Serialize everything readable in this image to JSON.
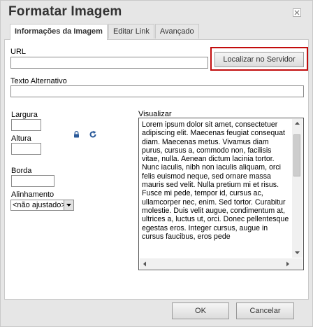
{
  "dialog": {
    "title": "Formatar Imagem"
  },
  "tabs": [
    {
      "label": "Informações da Imagem",
      "active": true
    },
    {
      "label": "Editar Link",
      "active": false
    },
    {
      "label": "Avançado",
      "active": false
    }
  ],
  "fields": {
    "url_label": "URL",
    "url_value": "",
    "browse_label": "Localizar no Servidor",
    "alt_label": "Texto Alternativo",
    "alt_value": "",
    "width_label": "Largura",
    "width_value": "",
    "height_label": "Altura",
    "height_value": "",
    "border_label": "Borda",
    "border_value": "",
    "align_label": "Alinhamento",
    "align_value": "<não ajustado>"
  },
  "preview": {
    "label": "Visualizar",
    "text": "Lorem ipsum dolor sit amet, consectetuer adipiscing elit. Maecenas feugiat consequat diam. Maecenas metus. Vivamus diam purus, cursus a, commodo non, facilisis vitae, nulla. Aenean dictum lacinia tortor. Nunc iaculis, nibh non iaculis aliquam, orci felis euismod neque, sed ornare massa mauris sed velit. Nulla pretium mi et risus. Fusce mi pede, tempor id, cursus ac, ullamcorper nec, enim. Sed tortor. Curabitur molestie. Duis velit augue, condimentum at, ultrices a, luctus ut, orci. Donec pellentesque egestas eros. Integer cursus, augue in cursus faucibus, eros pede"
  },
  "footer": {
    "ok_label": "OK",
    "cancel_label": "Cancelar"
  },
  "icons": {
    "lock": "lock-icon",
    "reset": "reset-size-icon",
    "close": "close-icon"
  },
  "colors": {
    "highlight": "#c20c0c",
    "icon_blue": "#2a5a9a"
  }
}
